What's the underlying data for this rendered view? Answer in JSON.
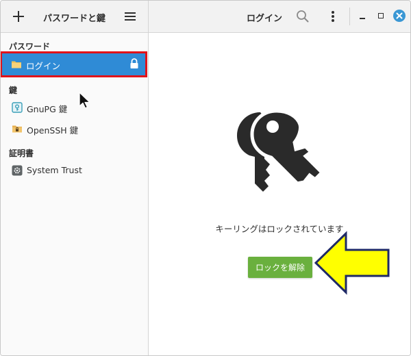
{
  "header": {
    "app_title": "パスワードと鍵",
    "view_title": "ログイン"
  },
  "sidebar": {
    "sections": [
      {
        "title": "パスワード",
        "items": [
          {
            "label": "ログイン",
            "icon": "folder-icon",
            "selected": true,
            "locked": true
          }
        ]
      },
      {
        "title": "鍵",
        "items": [
          {
            "label": "GnuPG 鍵",
            "icon": "gnupg-keyring-icon"
          },
          {
            "label": "OpenSSH 鍵",
            "icon": "openssh-folder-icon"
          }
        ]
      },
      {
        "title": "証明書",
        "items": [
          {
            "label": "System Trust",
            "icon": "gear-icon"
          }
        ]
      }
    ]
  },
  "main": {
    "status_text": "キーリングはロックされています",
    "unlock_button": "ロックを解除"
  },
  "colors": {
    "selection": "#2f8bd6",
    "highlight_outline": "#e0131a",
    "unlock_button": "#6ab03e",
    "close_button": "#3a97d4",
    "annotation_arrow": "#ffff00"
  }
}
